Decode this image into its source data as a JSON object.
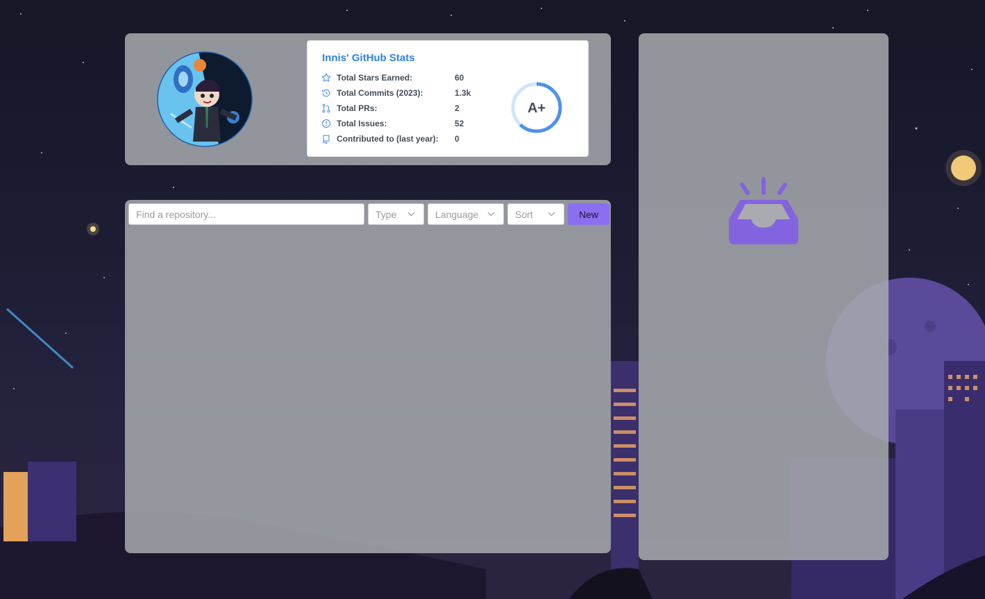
{
  "profile": {
    "avatar_icon": "octocat-avatar"
  },
  "stats_card": {
    "title": "Innis' GitHub Stats",
    "rows": [
      {
        "icon": "star-icon",
        "label": "Total Stars Earned:",
        "value": "60"
      },
      {
        "icon": "history-icon",
        "label": "Total Commits (2023):",
        "value": "1.3k"
      },
      {
        "icon": "pull-request-icon",
        "label": "Total PRs:",
        "value": "2"
      },
      {
        "icon": "issue-icon",
        "label": "Total Issues:",
        "value": "52"
      },
      {
        "icon": "repo-icon",
        "label": "Contributed to (last year):",
        "value": "0"
      }
    ],
    "rank": "A+",
    "rank_progress": 0.62,
    "colors": {
      "title": "#2f80ed",
      "text": "#434d58",
      "ring": "#4f92ea",
      "ring_track": "#d3e3fb"
    }
  },
  "repo_toolbar": {
    "search_placeholder": "Find a repository...",
    "type_label": "Type",
    "language_label": "Language",
    "sort_label": "Sort",
    "new_label": "New",
    "accent": "#8c6ef0"
  },
  "side_panel": {
    "empty_icon": "inbox-icon",
    "icon_color": "#8463e0"
  }
}
